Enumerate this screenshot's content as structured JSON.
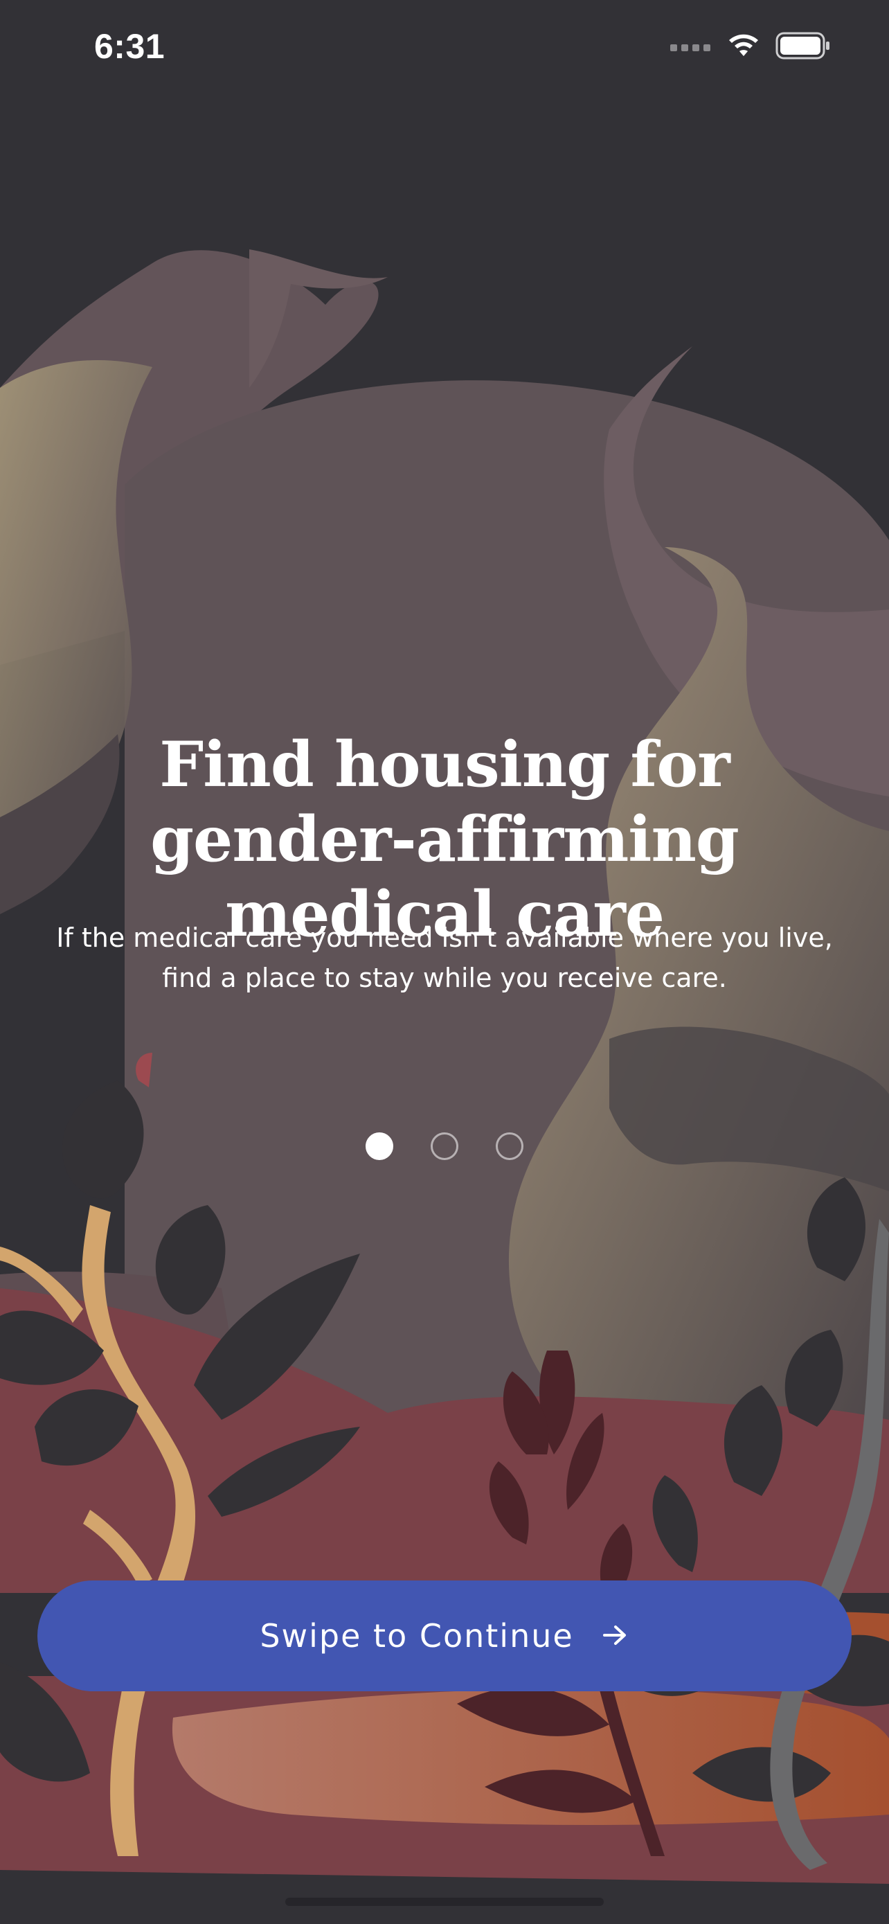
{
  "status_bar": {
    "time": "6:31",
    "icons": [
      "cellular-signal-icon",
      "wifi-icon",
      "battery-icon"
    ]
  },
  "onboarding": {
    "title": "Find housing for gender-affirming medical care",
    "description": "If the medical care you need isn't available where you live, find a place to stay while you receive care.",
    "pages": 3,
    "current_page": 1
  },
  "cta": {
    "label": "Swipe to Continue",
    "icon": "arrow-right-icon"
  },
  "colors": {
    "background": "#323136",
    "button": "#4256b2",
    "text": "#ffffff"
  }
}
